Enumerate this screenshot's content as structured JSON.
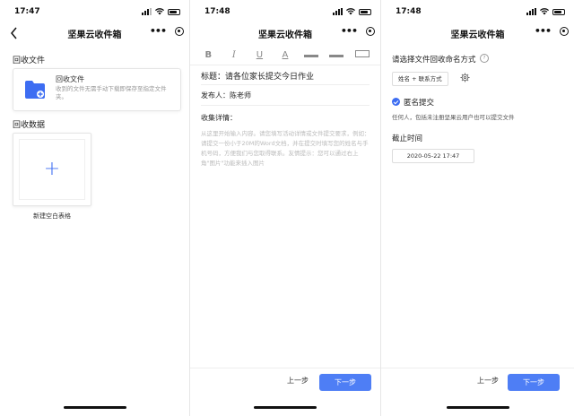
{
  "status": {
    "time": "17:47",
    "time_s2": "17:48"
  },
  "nav": {
    "title": "坚果云收件箱",
    "more": "•••"
  },
  "screen1": {
    "section_collect": "回收文件",
    "card_title": "回收文件",
    "card_desc": "收到的文件无需手动下载即保存至指定文件夹。",
    "section_data": "回收数据",
    "add_label": "新建空白表格"
  },
  "screen2": {
    "toolbar": [
      "B",
      "I",
      "U",
      "A"
    ],
    "title_line": "标题：请各位家长提交今日作业",
    "publisher_line": "发布人：陈老师",
    "details_label": "收集详情：",
    "placeholder": "从这里开始输入内容。请您填写活动详情或文件提交要求，例如：请提交一份小于20M的Word文档，并在提交时填写您的姓名与手机号码，方便我们与您取得联系。友情提示：您可以通过右上角\"图片\"功能来插入图片",
    "prev": "上一步",
    "next": "下一步"
  },
  "screen3": {
    "naming_title": "请选择文件回收命名方式",
    "help": "?",
    "chip": "姓名 + 联系方式",
    "anon_label": "匿名提交",
    "anon_desc": "任何人，包括未注册坚果云用户也可以提交文件",
    "deadline_title": "截止时间",
    "deadline_value": "2020-05-22 17:47",
    "prev": "上一步",
    "next": "下一步"
  },
  "colors": {
    "accent": "#3d6df2",
    "button": "#4e7ef5"
  }
}
